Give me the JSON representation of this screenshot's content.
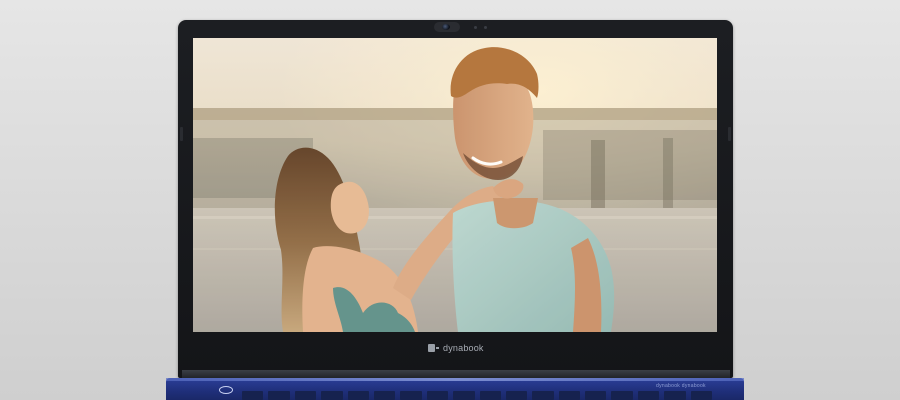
{
  "laptop": {
    "brand_label": "dynabook",
    "deck_label": "dynabook   dynabook"
  },
  "colors": {
    "background": "#dcdcdc",
    "bezel": "#17181b",
    "chassis_blue": "#22338a"
  },
  "icons": {
    "logo": "dynabook-mark-icon",
    "camera": "webcam-icon",
    "power": "power-button-icon"
  },
  "screen_content": {
    "subject": "couple-photo"
  }
}
